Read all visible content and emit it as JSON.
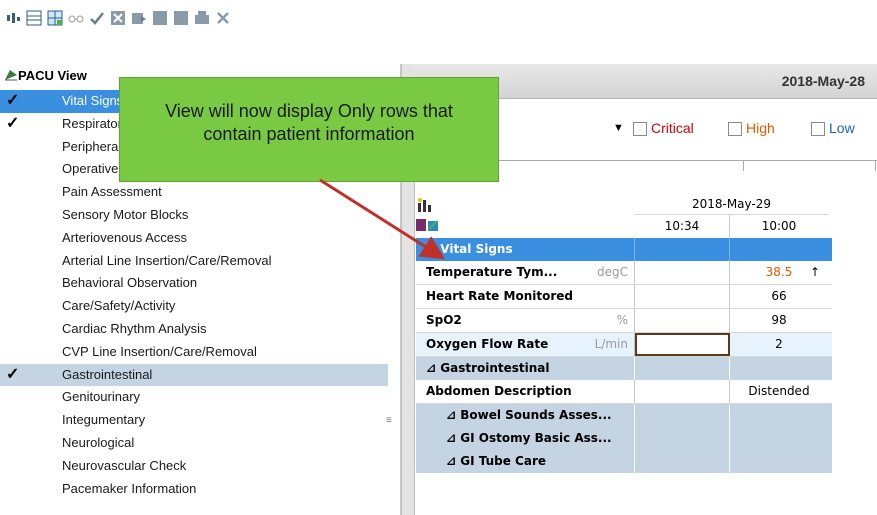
{
  "toolbar": {
    "icons": [
      "sort-icon",
      "rows-icon",
      "grid-add-icon",
      "glasses-icon",
      "check-icon",
      "close-box-icon",
      "send-icon",
      "square-icon",
      "square-icon-2",
      "print-icon",
      "clear-icon"
    ]
  },
  "left_panel": {
    "title": "PACU View",
    "items": [
      {
        "label": "Vital Signs",
        "state": "selected",
        "checked": true
      },
      {
        "label": "Respiratory",
        "state": "normal",
        "checked": true
      },
      {
        "label": "Peripheral",
        "state": "normal",
        "checked": false
      },
      {
        "label": "Operative",
        "state": "normal",
        "checked": false
      },
      {
        "label": "Pain Assessment",
        "state": "normal",
        "checked": false
      },
      {
        "label": "Sensory Motor Blocks",
        "state": "normal",
        "checked": false
      },
      {
        "label": "Arteriovenous Access",
        "state": "normal",
        "checked": false
      },
      {
        "label": "Arterial Line Insertion/Care/Removal",
        "state": "normal",
        "checked": false
      },
      {
        "label": "Behavioral Observation",
        "state": "normal",
        "checked": false
      },
      {
        "label": "Care/Safety/Activity",
        "state": "normal",
        "checked": false
      },
      {
        "label": "Cardiac Rhythm Analysis",
        "state": "normal",
        "checked": false
      },
      {
        "label": "CVP Line Insertion/Care/Removal",
        "state": "normal",
        "checked": false
      },
      {
        "label": "Gastrointestinal",
        "state": "highlight",
        "checked": true
      },
      {
        "label": "Genitourinary",
        "state": "normal",
        "checked": false
      },
      {
        "label": "Integumentary",
        "state": "normal",
        "checked": false
      },
      {
        "label": "Neurological",
        "state": "normal",
        "checked": false
      },
      {
        "label": "Neurovascular Check",
        "state": "normal",
        "checked": false
      },
      {
        "label": "Pacemaker Information",
        "state": "normal",
        "checked": false
      }
    ]
  },
  "right_header": {
    "date": "2018-May-28"
  },
  "filters": {
    "critical": "Critical",
    "high": "High",
    "low": "Low",
    "colors": {
      "critical": "#d40000",
      "high": "#e05a00",
      "low": "#1f5fbf"
    }
  },
  "grid": {
    "date_label": "2018-May-29",
    "times": [
      "10:34",
      "10:00"
    ],
    "sections": {
      "vital_signs": "Vital Signs",
      "gastrointestinal": "Gastrointestinal"
    },
    "rows": [
      {
        "label": "Temperature Tym...",
        "unit": "degC",
        "v1": "",
        "v2": "38.5",
        "flag": "↑"
      },
      {
        "label": "Heart Rate Monitored",
        "unit": "",
        "v1": "",
        "v2": "66"
      },
      {
        "label": "SpO2",
        "unit": "%",
        "v1": "",
        "v2": "98"
      },
      {
        "label": "Oxygen Flow Rate",
        "unit": "L/min",
        "v1": "",
        "v2": "2"
      }
    ],
    "gi_rows": [
      {
        "label": "Abdomen Description",
        "v1": "",
        "v2": "Distended"
      }
    ],
    "sub_sections": [
      "Bowel Sounds Asses...",
      "GI Ostomy Basic Ass...",
      "GI Tube Care"
    ],
    "collapse_glyph": "⊿"
  },
  "callout": {
    "line1": "View will now display Only rows that",
    "line2": "contain patient information"
  }
}
